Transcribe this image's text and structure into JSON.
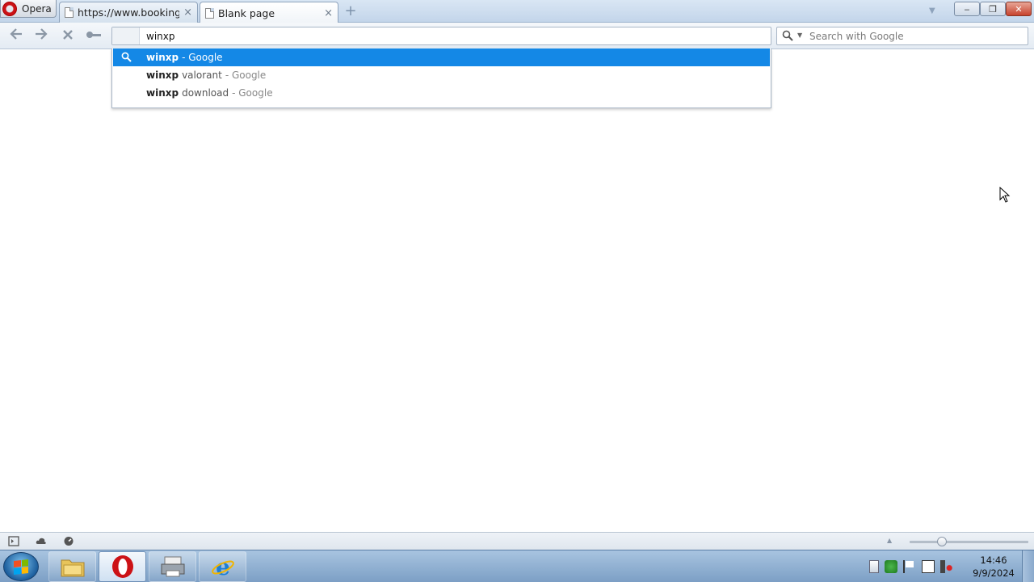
{
  "browser": {
    "menu_label": "Opera",
    "tabs": [
      {
        "title": "https://www.booking.c...",
        "active": false
      },
      {
        "title": "Blank page",
        "active": true
      }
    ],
    "new_tab_symbol": "+",
    "close_symbol": "×"
  },
  "window_controls": {
    "minimize": "‒",
    "restore": "❐",
    "close": "✕"
  },
  "navigation": {
    "back_symbol": "🡐",
    "forward_symbol": "🡒",
    "stop_symbol": "✕",
    "key_symbol": "⚷"
  },
  "address_bar": {
    "value": "winxp"
  },
  "search_box": {
    "placeholder": "Search with Google"
  },
  "suggestions": [
    {
      "query": "winxp",
      "suffix": "",
      "engine": "- Google",
      "selected": true
    },
    {
      "query": "winxp",
      "suffix": "valorant",
      "engine": "- Google",
      "selected": false
    },
    {
      "query": "winxp",
      "suffix": "download",
      "engine": "- Google",
      "selected": false
    }
  ],
  "statusbar": {
    "zoom_fraction": 0.27
  },
  "taskbar": {
    "apps": [
      "file-explorer",
      "opera",
      "printer-tool",
      "internet-explorer"
    ],
    "clock_time": "14:46",
    "clock_date": "9/9/2024"
  },
  "colors": {
    "accent": "#1488e6",
    "opera_red": "#cc1216"
  }
}
